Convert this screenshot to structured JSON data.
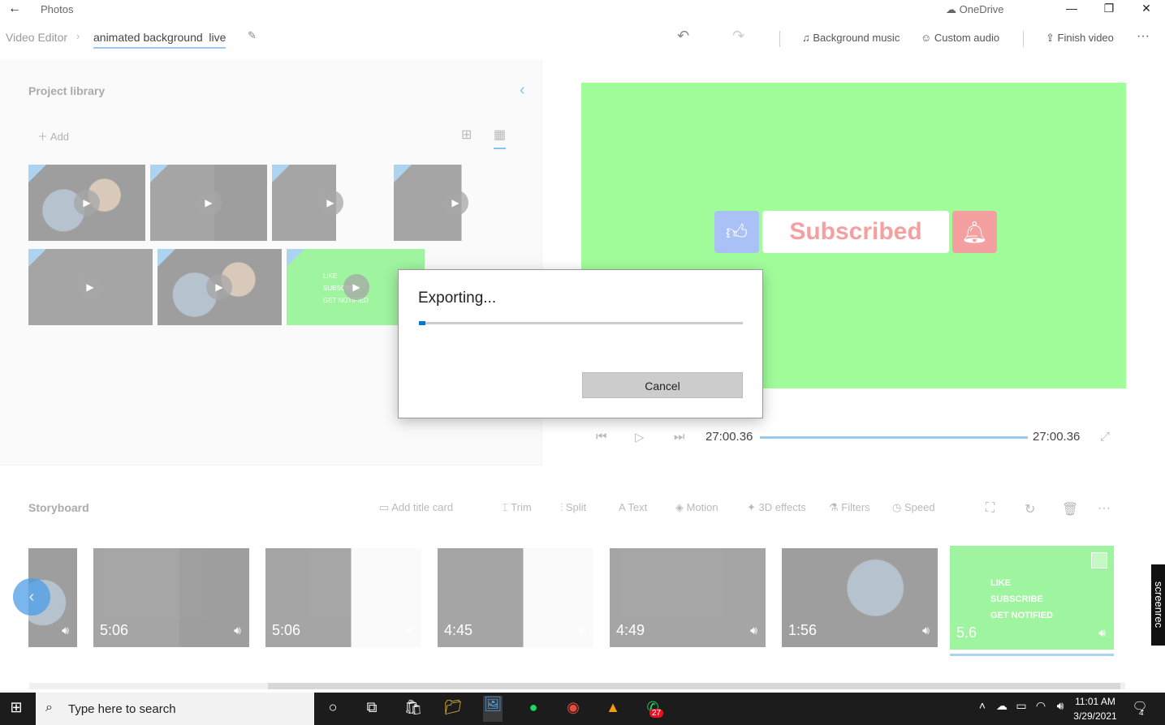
{
  "titlebar": {
    "back_icon": "back-arrow-icon",
    "app_name": "Photos",
    "onedrive": "OneDrive"
  },
  "toolbar": {
    "breadcrumb_root": "Video Editor",
    "project_name": "animated background  live",
    "undo_icon": "undo-icon",
    "redo_icon": "redo-icon",
    "background_music": "Background music",
    "custom_audio": "Custom audio",
    "finish_video": "Finish video",
    "more": "···"
  },
  "library": {
    "title": "Project library",
    "add_label": "Add",
    "thumb_overlay_green": {
      "line1": "LIKE",
      "line2": "SUBSCRIBE",
      "line3": "GET NOTIFIED"
    }
  },
  "preview": {
    "subscribed_text": "Subscribed",
    "time_current": "27:00.36",
    "time_total": "27:00.36"
  },
  "storyboard": {
    "title": "Storyboard",
    "tools": [
      "Add title card",
      "Trim",
      "Split",
      "Text",
      "Motion",
      "3D effects",
      "Filters",
      "Speed"
    ],
    "clips": [
      {
        "duration": "5:06"
      },
      {
        "duration": "5:06"
      },
      {
        "duration": "4:45"
      },
      {
        "duration": "4:49"
      },
      {
        "duration": "1:56"
      },
      {
        "duration": "5.6"
      }
    ],
    "last_clip_labels": {
      "like": "LIKE",
      "subscribe": "SUBSCRIBE",
      "notified": "GET NOTIFIED"
    }
  },
  "dialog": {
    "title": "Exporting...",
    "progress": 0.02,
    "cancel": "Cancel"
  },
  "taskbar": {
    "search_placeholder": "Type here to search",
    "time": "11:01 AM",
    "date": "3/29/2021",
    "notification_count": "4",
    "whatsapp_badge": "27"
  },
  "screenrec": "screenrec",
  "colors": {
    "accent": "#0078d4",
    "preview_bg": "#a0fd9a",
    "green_clip": "#2de82d"
  }
}
